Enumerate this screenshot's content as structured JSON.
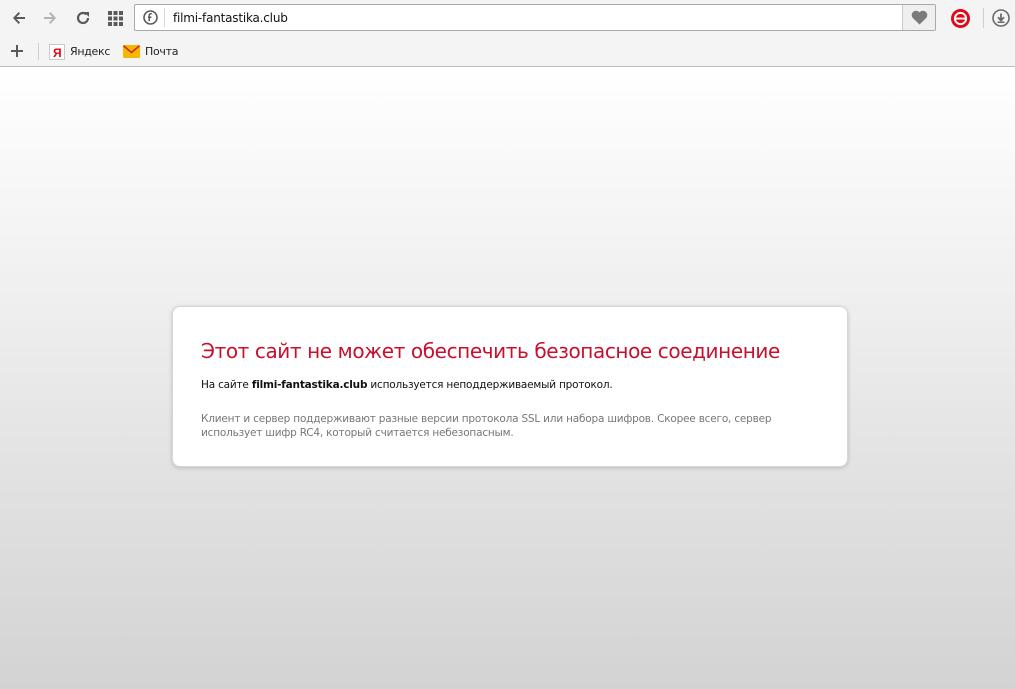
{
  "toolbar": {
    "url": "filmi-fantastika.club"
  },
  "bookmarks": [
    {
      "label": "Яндекс",
      "icon": "yandex-icon"
    },
    {
      "label": "Почта",
      "icon": "mail-icon"
    }
  ],
  "error": {
    "title": "Этот сайт не может обеспечить безопасное соединение",
    "line_prefix": "На сайте ",
    "line_domain": "filmi-fantastika.club",
    "line_suffix": " используется неподдерживаемый протокол.",
    "details": "Клиент и сервер поддерживают разные версии протокола SSL или набора шифров. Скорее всего, сервер использует шифр RC4, который считается небезопасным."
  },
  "colors": {
    "title_red": "#c8102e",
    "ext_red": "#e30613",
    "mail_yellow": "#f5b800"
  }
}
